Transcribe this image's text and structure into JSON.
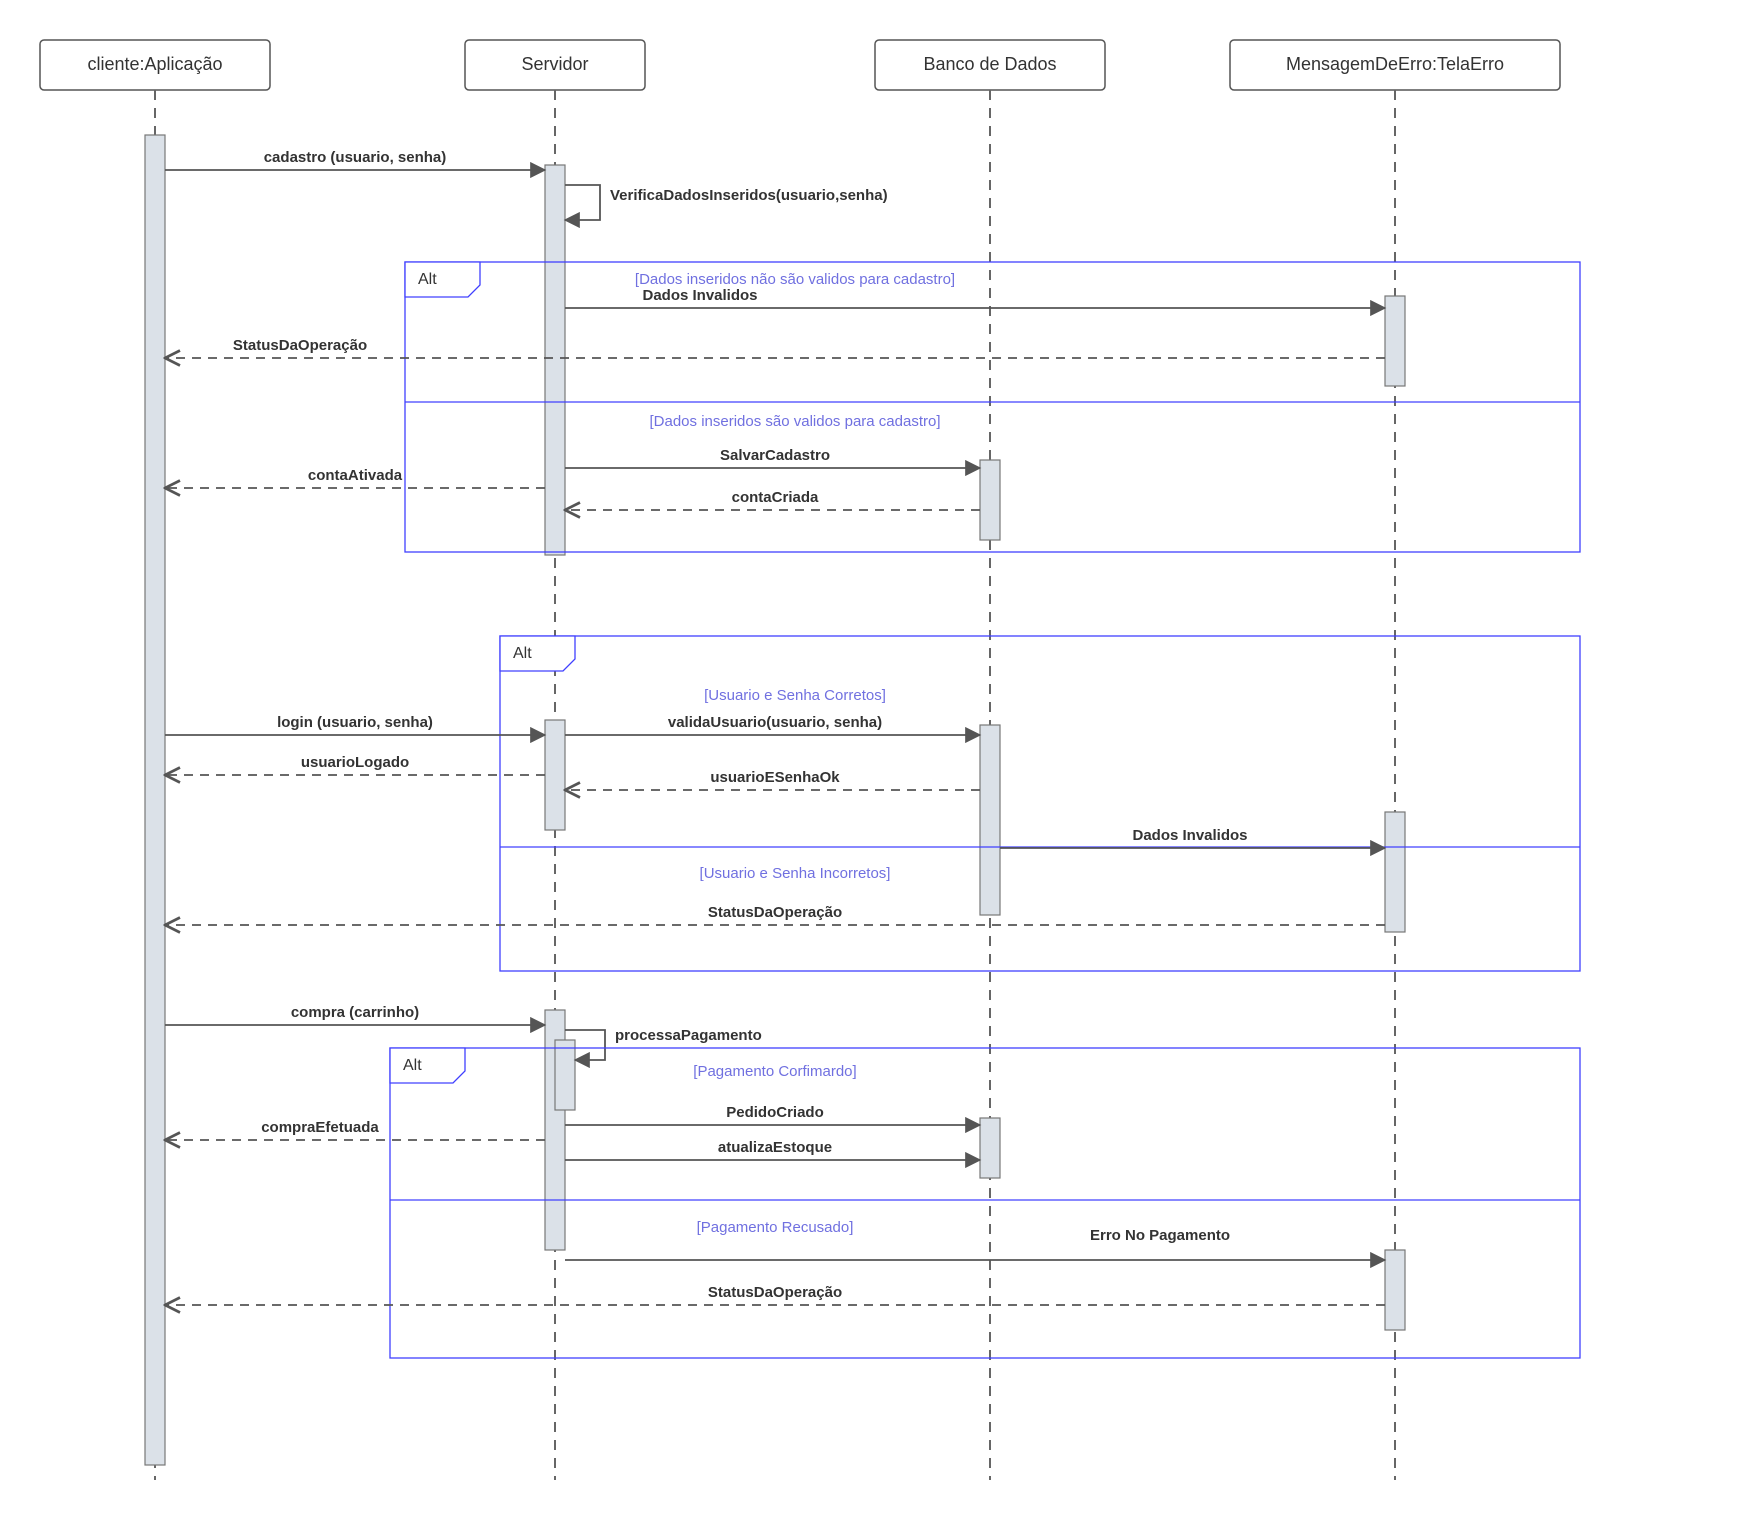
{
  "lifelines": {
    "l0": "cliente:Aplicação",
    "l1": "Servidor",
    "l2": "Banco de Dados",
    "l3": "MensagemDeErro:TelaErro"
  },
  "fragments": {
    "alt": "Alt"
  },
  "guards": {
    "g1": "[Dados inseridos não são validos para cadastro]",
    "g2": "[Dados inseridos são validos para cadastro]",
    "g3": "[Usuario e Senha Corretos]",
    "g4": "[Usuario e Senha Incorretos]",
    "g5": "[Pagamento Corfimardo]",
    "g6": "[Pagamento Recusado]"
  },
  "messages": {
    "cadastro": "cadastro (usuario, senha)",
    "verifica": "VerificaDadosInseridos(usuario,senha)",
    "dadosInvalidos": "Dados Invalidos",
    "statusOp": "StatusDaOperação",
    "salvarCadastro": "SalvarCadastro",
    "contaCriada": "contaCriada",
    "contaAtivada": "contaAtivada",
    "login": "login (usuario, senha)",
    "validaUsuario": "validaUsuario(usuario, senha)",
    "usuarioESenhaOk": "usuarioESenhaOk",
    "usuarioLogado": "usuarioLogado",
    "compra": "compra (carrinho)",
    "processaPag": "processaPagamento",
    "pedidoCriado": "PedidoCriado",
    "atualizaEstoque": "atualizaEstoque",
    "compraEfetuada": "compraEfetuada",
    "erroPag": "Erro No Pagamento"
  }
}
